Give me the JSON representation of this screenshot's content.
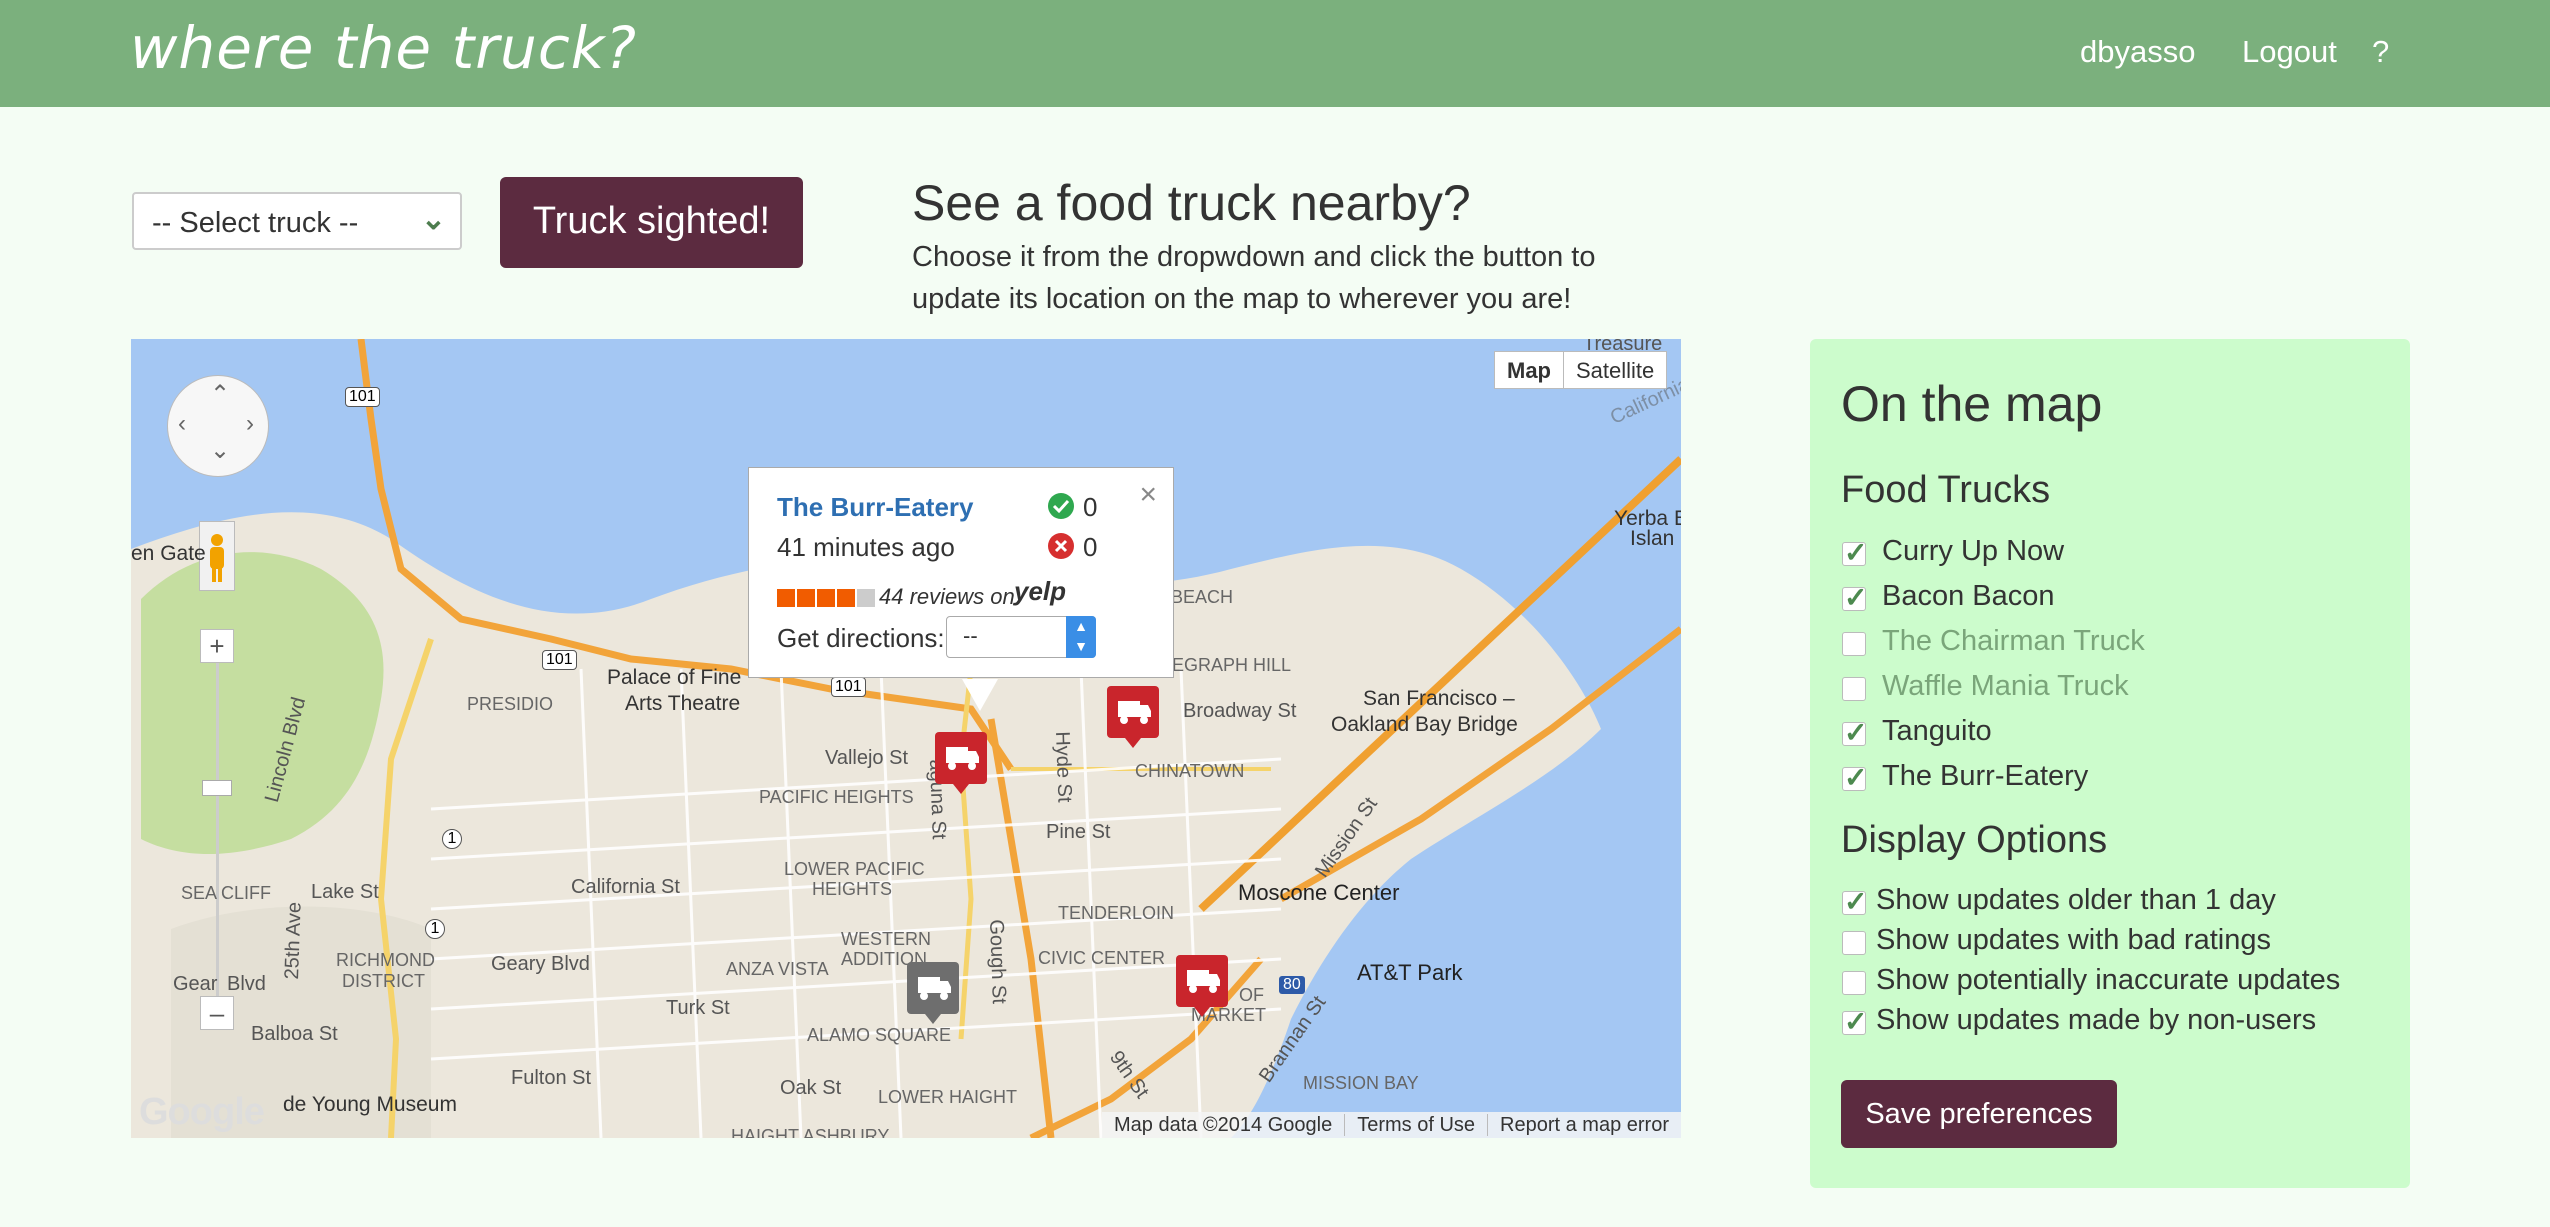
{
  "navbar": {
    "brand": "where the truck?",
    "user": "dbyasso",
    "logout": "Logout",
    "help": "?"
  },
  "controls": {
    "select_value": "-- Select truck --",
    "sighted_button": "Truck sighted!"
  },
  "intro": {
    "title": "See a food truck nearby?",
    "text": "Choose it from the dropwdown and click the button to update its location on the map to wherever you are!"
  },
  "map": {
    "type_map": "Map",
    "type_satellite": "Satellite",
    "zoom_in": "+",
    "zoom_out": "–",
    "attribution": [
      "Map data ©2014 Google",
      "Terms of Use",
      "Report a map error"
    ],
    "logo": "Google",
    "labels": {
      "presidio": "PRESIDIO",
      "palace": "Palace of Fine",
      "arts": "Arts Theatre",
      "vallejo": "Vallejo St",
      "pacific_heights": "PACIFIC HEIGHTS",
      "chinatown": "CHINATOWN",
      "telegraph": "EGRAPH HILL",
      "beach": "BEACH",
      "broadway": "Broadway St",
      "sf_bay_bridge_1": "San Francisco –",
      "sf_bay_bridge_2": "Oakland Bay Bridge",
      "lower_pacific_1": "LOWER PACIFIC",
      "lower_pacific_2": "HEIGHTS",
      "pine": "Pine St",
      "california": "California St",
      "lake": "Lake St",
      "sea_cliff": "SEA CLIFF",
      "lincoln": "Lincoln Blvd",
      "richmond_1": "RICHMOND",
      "richmond_2": "DISTRICT",
      "geary": "Geary Blvd",
      "gear": "Gear",
      "blvd": "Blvd",
      "balboa": "Balboa St",
      "ave25": "25th Ave",
      "western_1": "WESTERN",
      "western_2": "ADDITION",
      "anza": "ANZA VISTA",
      "turk": "Turk St",
      "alamo": "ALAMO SQUARE",
      "fulton": "Fulton St",
      "young": "de Young Museum",
      "oak": "Oak St",
      "lower_haight": "LOWER HAIGHT",
      "haight": "HAIGHT ASHBURY",
      "tenderloin": "TENDERLOIN",
      "civic": "CIVIC CENTER",
      "of": "OF",
      "market": "MARKET",
      "moscone": "Moscone Center",
      "att": "AT&T Park",
      "mission_bay": "MISSION BAY",
      "mission": "Mission St",
      "brannan": "Brannan St",
      "ninth": "9th St",
      "gough": "Gough St",
      "hyde": "Hyde St",
      "laguna": "aguna St",
      "golden_gate": "en Gate",
      "yerba_1": "Yerba B",
      "yerba_2": "Islan",
      "california_top": "California",
      "treasure": "Treasure",
      "hwy101_a": "101",
      "hwy101_b": "101",
      "hwy101_c": "101",
      "hwy1_a": "1",
      "hwy1_b": "1",
      "hwy80": "80"
    },
    "popup": {
      "name": "The Burr-Eatery",
      "time": "41 minutes ago",
      "upvotes": "0",
      "downvotes": "0",
      "reviews": "44 reviews on",
      "yelp": "yelp",
      "directions_label": "Get directions:",
      "directions_value": "--",
      "close": "×"
    }
  },
  "panel": {
    "title": "On the map",
    "trucks_heading": "Food Trucks",
    "trucks": [
      {
        "label": "Curry Up Now",
        "checked": true
      },
      {
        "label": "Bacon Bacon",
        "checked": true
      },
      {
        "label": "The Chairman Truck",
        "checked": false
      },
      {
        "label": "Waffle Mania Truck",
        "checked": false
      },
      {
        "label": "Tanguito",
        "checked": true
      },
      {
        "label": "The Burr-Eatery",
        "checked": true
      }
    ],
    "options_heading": "Display Options",
    "options": [
      {
        "label": "Show updates older than 1 day",
        "checked": true
      },
      {
        "label": "Show updates with bad ratings",
        "checked": false
      },
      {
        "label": "Show potentially inaccurate updates",
        "checked": false
      },
      {
        "label": "Show updates made by non-users",
        "checked": true
      }
    ],
    "save_button": "Save preferences"
  },
  "colors": {
    "navbar": "#7bb07d",
    "button": "#5c2b40",
    "panel": "#ccfccc",
    "water": "#a4c7f3",
    "marker_red": "#c9252c",
    "marker_gray": "#6e6e6e"
  }
}
